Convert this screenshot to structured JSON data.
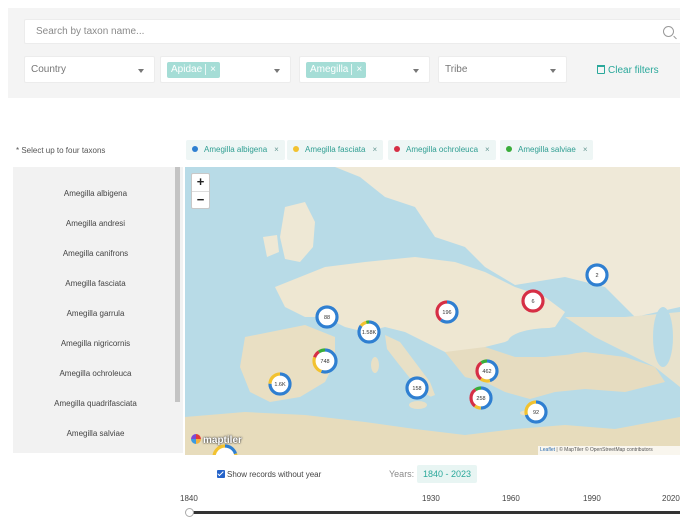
{
  "search": {
    "placeholder": "Search by taxon name..."
  },
  "filters": {
    "country": {
      "placeholder": "Country"
    },
    "family": {
      "chip": "Apidae",
      "remove": "×"
    },
    "genus": {
      "chip": "Amegilla",
      "remove": "×"
    },
    "tribe": {
      "placeholder": "Tribe"
    },
    "clear_label": "Clear filters"
  },
  "taxa": {
    "hint": "* Select up to four taxons",
    "selected": [
      {
        "name": "Amegilla albigena",
        "color": "#2f7fd1",
        "remove": "×"
      },
      {
        "name": "Amegilla fasciata",
        "color": "#f2c230",
        "remove": "×"
      },
      {
        "name": "Amegilla ochroleuca",
        "color": "#d62f45",
        "remove": "×"
      },
      {
        "name": "Amegilla salviae",
        "color": "#3aad3a",
        "remove": "×"
      }
    ]
  },
  "species_list": [
    "Amegilla albigena",
    "Amegilla andresi",
    "Amegilla canifrons",
    "Amegilla fasciata",
    "Amegilla garrula",
    "Amegilla nigricornis",
    "Amegilla ochroleuca",
    "Amegilla quadrifasciata",
    "Amegilla salviae"
  ],
  "map": {
    "zoom_in": "+",
    "zoom_out": "−",
    "logo": "maptiler",
    "attribution_leaflet": "Leaflet",
    "attribution_rest": " | © MapTiler © OpenStreetMap contributors",
    "clusters": [
      {
        "label": "88"
      },
      {
        "label": "1.58K"
      },
      {
        "label": "196"
      },
      {
        "label": "6"
      },
      {
        "label": "2"
      },
      {
        "label": "748"
      },
      {
        "label": "1.6K"
      },
      {
        "label": "158"
      },
      {
        "label": "462"
      },
      {
        "label": "258"
      },
      {
        "label": "92"
      }
    ]
  },
  "timeline": {
    "checkbox_label": "Show records without year",
    "years_label": "Years:",
    "years_value": "1840 - 2023",
    "ticks": [
      "1840",
      "1930",
      "1960",
      "1990",
      "2020"
    ],
    "handle_year": 1840
  }
}
